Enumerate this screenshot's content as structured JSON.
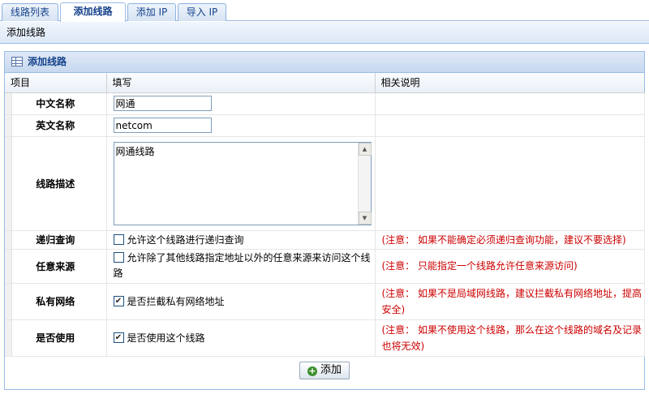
{
  "tabs": [
    {
      "label": "线路列表"
    },
    {
      "label": "添加线路"
    },
    {
      "label": "添加 IP"
    },
    {
      "label": "导入 IP"
    }
  ],
  "subtitle": "添加线路",
  "panel": {
    "title": "添加线路",
    "icon": "grid-icon"
  },
  "columns": {
    "item": "项目",
    "fill": "填写",
    "desc": "相关说明"
  },
  "rows": {
    "cn_name": {
      "label": "中文名称",
      "value": "网通"
    },
    "en_name": {
      "label": "英文名称",
      "value": "netcom"
    },
    "desc": {
      "label": "线路描述",
      "value": "网通线路"
    },
    "recursive": {
      "label": "递归查询",
      "check": "允许这个线路进行递归查询",
      "checked": false,
      "note": "(注意： 如果不能确定必须递归查询功能，建议不要选择)"
    },
    "any_source": {
      "label": "任意来源",
      "check": "允许除了其他线路指定地址以外的任意来源来访问这个线路",
      "checked": false,
      "note": "(注意： 只能指定一个线路允许任意来源访问)"
    },
    "private": {
      "label": "私有网络",
      "check": "是否拦截私有网络地址",
      "checked": true,
      "note": "(注意： 如果不是局域网线路，建议拦截私有网络地址，提高安全)"
    },
    "enabled": {
      "label": "是否使用",
      "check": "是否使用这个线路",
      "checked": true,
      "note": "(注意： 如果不使用这个线路，那么在这个线路的域名及记录也将无效)"
    }
  },
  "add_button": "添加",
  "colors": {
    "accent": "#15428b",
    "border": "#99bbe8",
    "note": "#cc0000"
  }
}
